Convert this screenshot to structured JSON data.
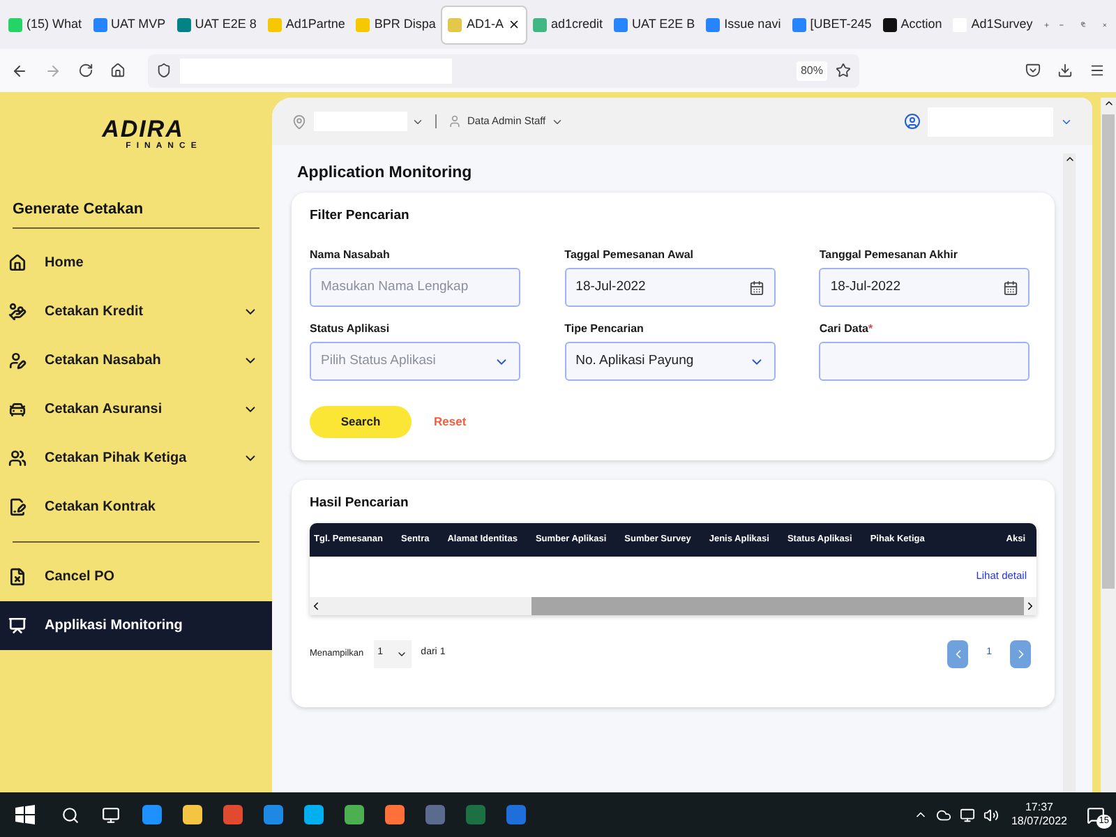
{
  "browser": {
    "tabs": [
      {
        "label": "(15) What",
        "selected": false
      },
      {
        "label": "UAT MVP",
        "selected": false
      },
      {
        "label": "UAT E2E 8",
        "selected": false
      },
      {
        "label": "Ad1Partne",
        "selected": false
      },
      {
        "label": "BPR Dispa",
        "selected": false
      },
      {
        "label": "AD1-A",
        "selected": true
      },
      {
        "label": "ad1credit",
        "selected": false
      },
      {
        "label": "UAT E2E B",
        "selected": false
      },
      {
        "label": "Issue navi",
        "selected": false
      },
      {
        "label": "[UBET-245",
        "selected": false
      },
      {
        "label": "Acction",
        "selected": false
      },
      {
        "label": "Ad1Survey",
        "selected": false
      }
    ],
    "zoom": "80%"
  },
  "sidebar": {
    "logo": {
      "name": "ADIRA",
      "sub": "FINANCE"
    },
    "section": "Generate Cetakan",
    "items": [
      {
        "label": "Home",
        "expandable": false,
        "selected": false
      },
      {
        "label": "Cetakan Kredit",
        "expandable": true,
        "selected": false
      },
      {
        "label": "Cetakan Nasabah",
        "expandable": true,
        "selected": false
      },
      {
        "label": "Cetakan Asuransi",
        "expandable": true,
        "selected": false
      },
      {
        "label": "Cetakan Pihak Ketiga",
        "expandable": true,
        "selected": false
      },
      {
        "label": "Cetakan Kontrak",
        "expandable": false,
        "selected": false
      }
    ],
    "extra_items": [
      {
        "label": "Cancel PO",
        "expandable": false,
        "selected": false
      },
      {
        "label": "Applikasi Monitoring",
        "expandable": false,
        "selected": true
      }
    ]
  },
  "header": {
    "role": "Data Admin Staff"
  },
  "page_title": "Application Monitoring",
  "filter": {
    "title": "Filter Pencarian",
    "fields": [
      {
        "label": "Nama Nasabah",
        "kind": "text",
        "placeholder": "Masukan Nama Lengkap"
      },
      {
        "label": "Taggal Pemesanan Awal",
        "kind": "date",
        "value": "18-Jul-2022"
      },
      {
        "label": "Tanggal Pemesanan Akhir",
        "kind": "date",
        "value": "18-Jul-2022"
      },
      {
        "label": "Status Aplikasi",
        "kind": "select",
        "placeholder": "Pilih Status Aplikasi"
      },
      {
        "label": "Tipe Pencarian",
        "kind": "select",
        "value": "No. Aplikasi Payung"
      },
      {
        "label": "Cari Data",
        "kind": "text",
        "required_mark": "*"
      }
    ],
    "search_button": "Search",
    "reset_button": "Reset"
  },
  "results": {
    "title": "Hasil Pencarian",
    "columns": [
      "Tgl. Pemesanan",
      "Sentra",
      "Alamat Identitas",
      "Sumber Aplikasi",
      "Sumber Survey",
      "Jenis Aplikasi",
      "Status Aplikasi",
      "Pihak Ketiga",
      "Aksi"
    ],
    "row_action": "Lihat detail",
    "pagination": {
      "label": "Menampilkan",
      "page_size": "1",
      "of": "dari",
      "total": "1",
      "current": "1"
    }
  },
  "taskbar": {
    "time": "17:37",
    "date": "18/07/2022",
    "notifications": "15"
  }
}
